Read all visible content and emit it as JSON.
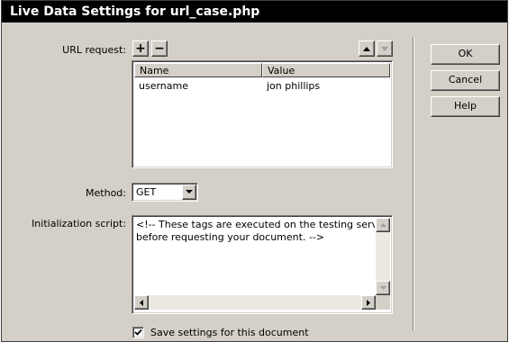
{
  "window": {
    "title": "Live Data Settings for url_case.php"
  },
  "url_request": {
    "label": "URL request:",
    "add_symbol": "+",
    "remove_symbol": "−",
    "table": {
      "headers": [
        "Name",
        "Value"
      ],
      "rows": [
        {
          "name": "username",
          "value": "jon phillips"
        }
      ]
    }
  },
  "method": {
    "label": "Method:",
    "selected": "GET"
  },
  "init_script": {
    "label": "Initialization script:",
    "lines": [
      "<!-- These tags are executed on the testing serve",
      "before requesting your document. -->"
    ]
  },
  "save_checkbox": {
    "label": "Save settings for this document",
    "checked": true
  },
  "buttons": {
    "ok": "OK",
    "cancel": "Cancel",
    "help": "Help"
  },
  "icons": [
    "plus-icon",
    "minus-icon",
    "up-arrow-icon",
    "down-arrow-icon",
    "dropdown-arrow-icon",
    "checkmark-icon"
  ]
}
